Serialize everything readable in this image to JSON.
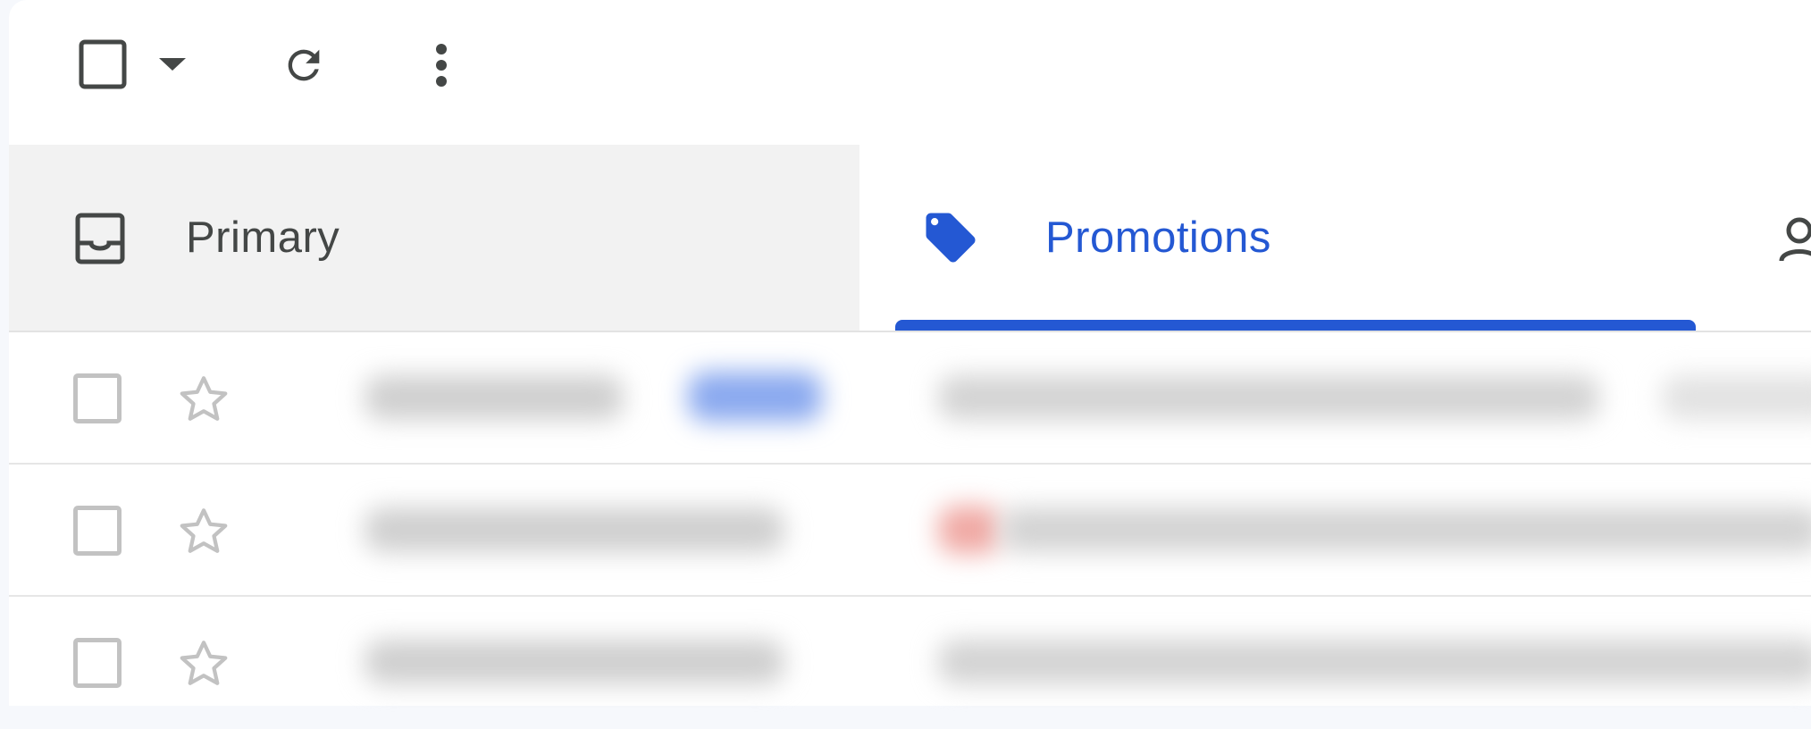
{
  "toolbar": {
    "select_all_icon": "checkbox-empty-icon",
    "select_menu_icon": "caret-down-icon",
    "refresh_icon": "refresh-icon",
    "more_icon": "more-vert-icon"
  },
  "tabs": [
    {
      "label": "Primary",
      "icon": "inbox-icon",
      "active": false
    },
    {
      "label": "Promotions",
      "icon": "tag-icon",
      "active": true
    },
    {
      "label": "",
      "icon": "people-icon",
      "active": false
    }
  ],
  "colors": {
    "accent": "#2458d3",
    "inactive_tab_bg": "#f2f2f2",
    "text_dark": "#444746",
    "icon_grey": "#c2c2c2"
  },
  "email_rows": [
    {
      "sender": "",
      "subject": "",
      "starred": false,
      "selected": false
    },
    {
      "sender": "",
      "subject": "",
      "starred": false,
      "selected": false
    },
    {
      "sender": "",
      "subject": "",
      "starred": false,
      "selected": false
    }
  ]
}
